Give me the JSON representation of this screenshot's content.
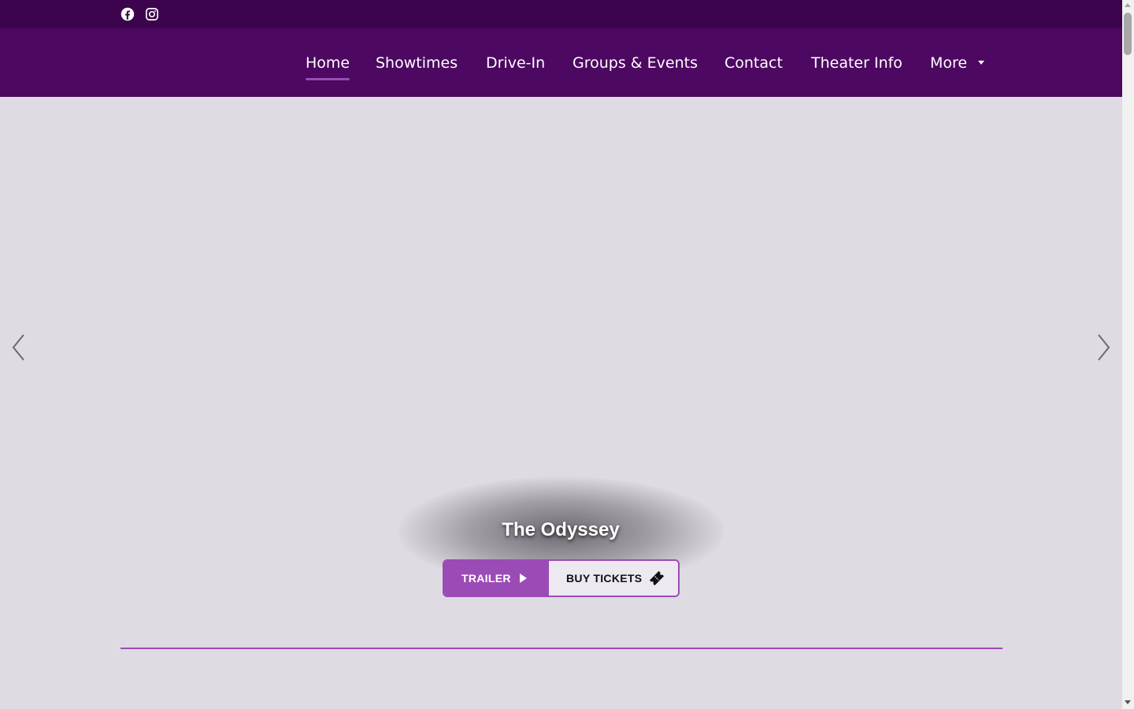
{
  "social": {
    "facebook_icon": "facebook-icon",
    "instagram_icon": "instagram-icon"
  },
  "nav": {
    "items": [
      {
        "label": "Home",
        "active": true
      },
      {
        "label": "Showtimes"
      },
      {
        "label": "Drive-In"
      },
      {
        "label": "Groups & Events"
      },
      {
        "label": "Contact"
      },
      {
        "label": "Theater Info"
      },
      {
        "label": "More"
      }
    ]
  },
  "hero": {
    "movie_title": "The Odyssey",
    "trailer_label": "TRAILER",
    "tickets_label": "BUY TICKETS",
    "prev_icon": "chevron-left-icon",
    "next_icon": "chevron-right-icon"
  },
  "colors": {
    "topbar": "#3c044c",
    "navbar": "#4d0862",
    "accent": "#9b4bb6",
    "hero_background": "#dedbe2"
  }
}
